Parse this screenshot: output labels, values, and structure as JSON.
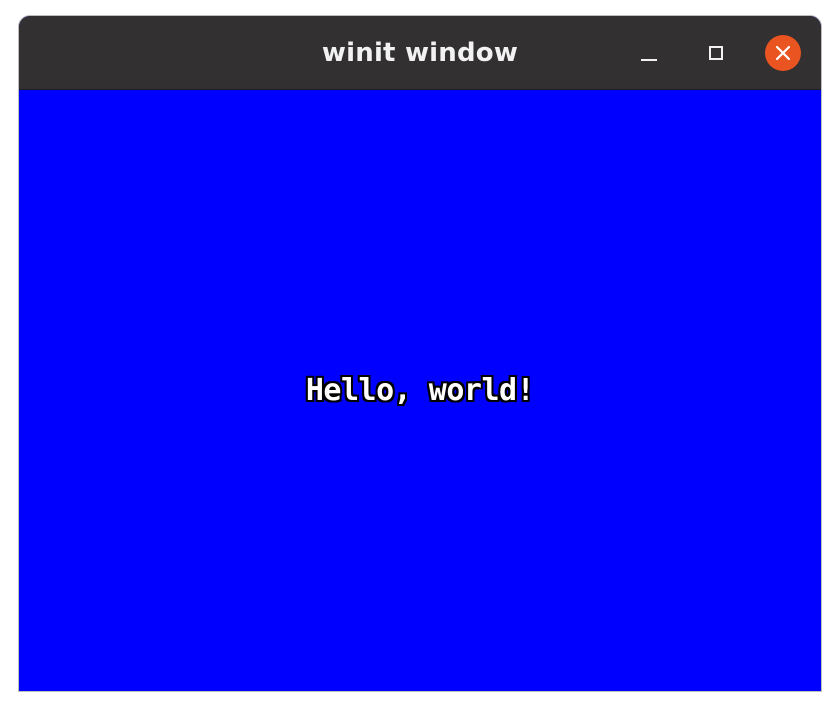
{
  "window": {
    "title": "winit window",
    "background_color": "#0000ff"
  },
  "titlebar": {
    "background_color": "#323030",
    "controls": {
      "minimize_icon": "minimize-icon",
      "maximize_icon": "maximize-icon",
      "close_icon": "close-icon",
      "close_color": "#e95420"
    }
  },
  "content": {
    "message": "Hello, world!"
  }
}
